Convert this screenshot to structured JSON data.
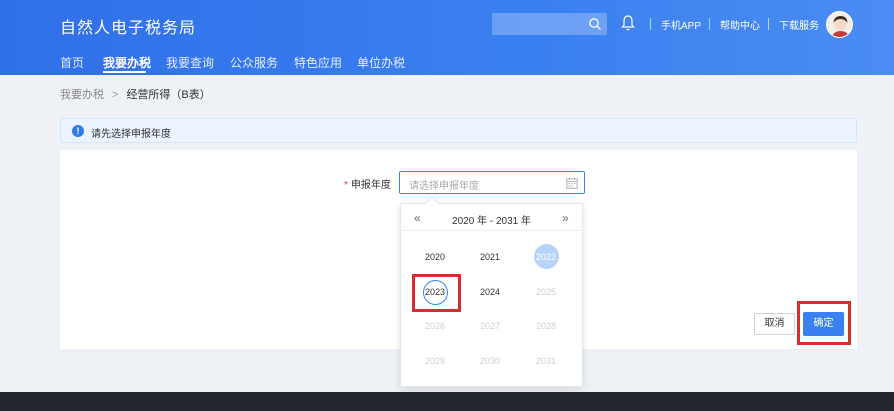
{
  "header": {
    "brand": "自然人电子税务局",
    "links": [
      "手机APP",
      "帮助中心",
      "下载服务"
    ]
  },
  "nav": {
    "items": [
      "首页",
      "我要办税",
      "我要查询",
      "公众服务",
      "特色应用",
      "单位办税"
    ],
    "active_index": 1
  },
  "breadcrumb": {
    "parent": "我要办税",
    "separator": ">",
    "current": "经营所得（B表）"
  },
  "notice": {
    "text": "请先选择申报年度"
  },
  "form": {
    "required_mark": "*",
    "year_label": "申报年度",
    "year_placeholder": "请选择申报年度"
  },
  "picker": {
    "prev": "«",
    "next": "»",
    "range_title": "2020 年 - 2031 年",
    "years": [
      "2020",
      "2021",
      "2022",
      "2023",
      "2024",
      "2025",
      "2026",
      "2027",
      "2028",
      "2029",
      "2030",
      "2031"
    ],
    "selected": "2022",
    "current": "2023",
    "enabled_years": [
      "2020",
      "2021",
      "2022",
      "2023",
      "2024"
    ]
  },
  "actions": {
    "cancel": "取消",
    "confirm": "确定"
  },
  "colors": {
    "primary": "#3b80f0",
    "highlight": "#d32f2f"
  }
}
